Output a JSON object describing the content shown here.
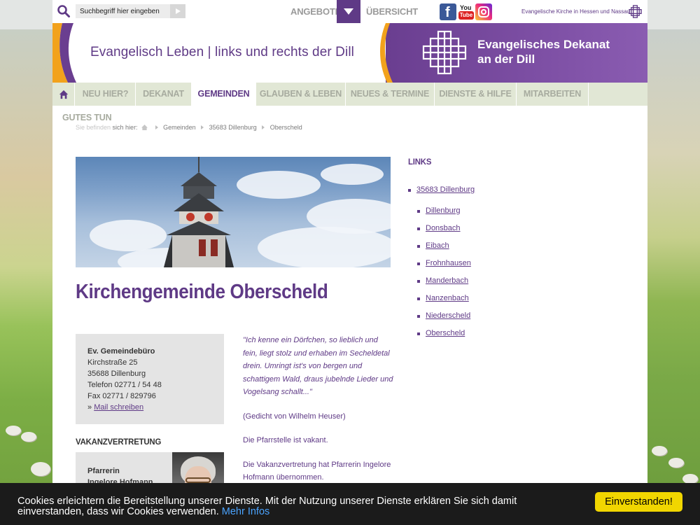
{
  "topbar": {
    "search_placeholder": "Suchbegriff hier eingeben",
    "angebote_label": "ANGEBOTE",
    "uebersicht_label": "ÜBERSICHT",
    "facebook_glyph": "f",
    "youtube_top": "You",
    "youtube_bottom": "Tube",
    "ekhn_label": "Evangelische Kirche in Hessen und Nassau"
  },
  "banner": {
    "claim": "Evangelisch Leben | links und rechts der Dill",
    "title_line1": "Evangelisches Dekanat",
    "title_line2": "an der Dill",
    "purple": "#6a3e90",
    "orange": "#f2a21c"
  },
  "nav": {
    "items": [
      {
        "label": "NEU HIER?"
      },
      {
        "label": "DEKANAT"
      },
      {
        "label": "GEMEINDEN",
        "active": true
      },
      {
        "label": "GLAUBEN & LEBEN"
      },
      {
        "label": "NEUES & TERMINE"
      },
      {
        "label": "DIENSTE & HILFE"
      },
      {
        "label": "MITARBEITEN"
      }
    ],
    "overflow_label": "GUTES TUN"
  },
  "breadcrumb": {
    "prefix_faded": "Sie befinden ",
    "prefix": "sich hier:",
    "items": [
      "Gemeinden",
      "35683 Dillenburg",
      "Oberscheld"
    ]
  },
  "page": {
    "title": "Kirchengemeinde Oberscheld"
  },
  "office": {
    "name": "Ev. Gemeindebüro",
    "street": "Kirchstraße 25",
    "city": "35688 Dillenburg",
    "phone": "Telefon 02771 / 54 48",
    "fax": "Fax 02771 / 829796",
    "mail_prefix": "» ",
    "mail_label": "Mail schreiben"
  },
  "vacancy": {
    "heading": "VAKANZVERTRETUNG",
    "role": "Pfarrerin",
    "name": "Ingelore Hofmann"
  },
  "text": {
    "quote": "\"Ich kenne ein Dörfchen, so lieblich und fein, liegt stolz und erhaben im Secheldetal drein. Umringt ist's von bergen und schattigem Wald, draus jubelnde Lieder und Vogelsang schallt...\"",
    "quote_source": "(Gedicht von Wilhelm Heuser)",
    "vacant": "Die Pfarrstelle ist vakant.",
    "replacement": "Die Vakanzvertretung hat Pfarrerin Ingelore Hofmann übernommen."
  },
  "sidebar": {
    "heading": "LINKS",
    "parent": "35683 Dillenburg",
    "children": [
      "Dillenburg",
      "Donsbach",
      "Eibach",
      "Frohnhausen",
      "Manderbach",
      "Nanzenbach",
      "Niederscheld",
      "Oberscheld"
    ]
  },
  "cookie": {
    "text": "Cookies erleichtern die Bereitstellung unserer Dienste. Mit der Nutzung unserer Dienste erklären Sie sich damit einverstanden, dass wir Cookies verwenden.",
    "more_label": "Mehr Infos",
    "accept_label": "Einverstanden!"
  },
  "colors": {
    "accent": "#5f3a86",
    "nav_bg": "#e1e7d5",
    "cookie_bg": "#1b1b1b",
    "cookie_button": "#f1d600"
  }
}
